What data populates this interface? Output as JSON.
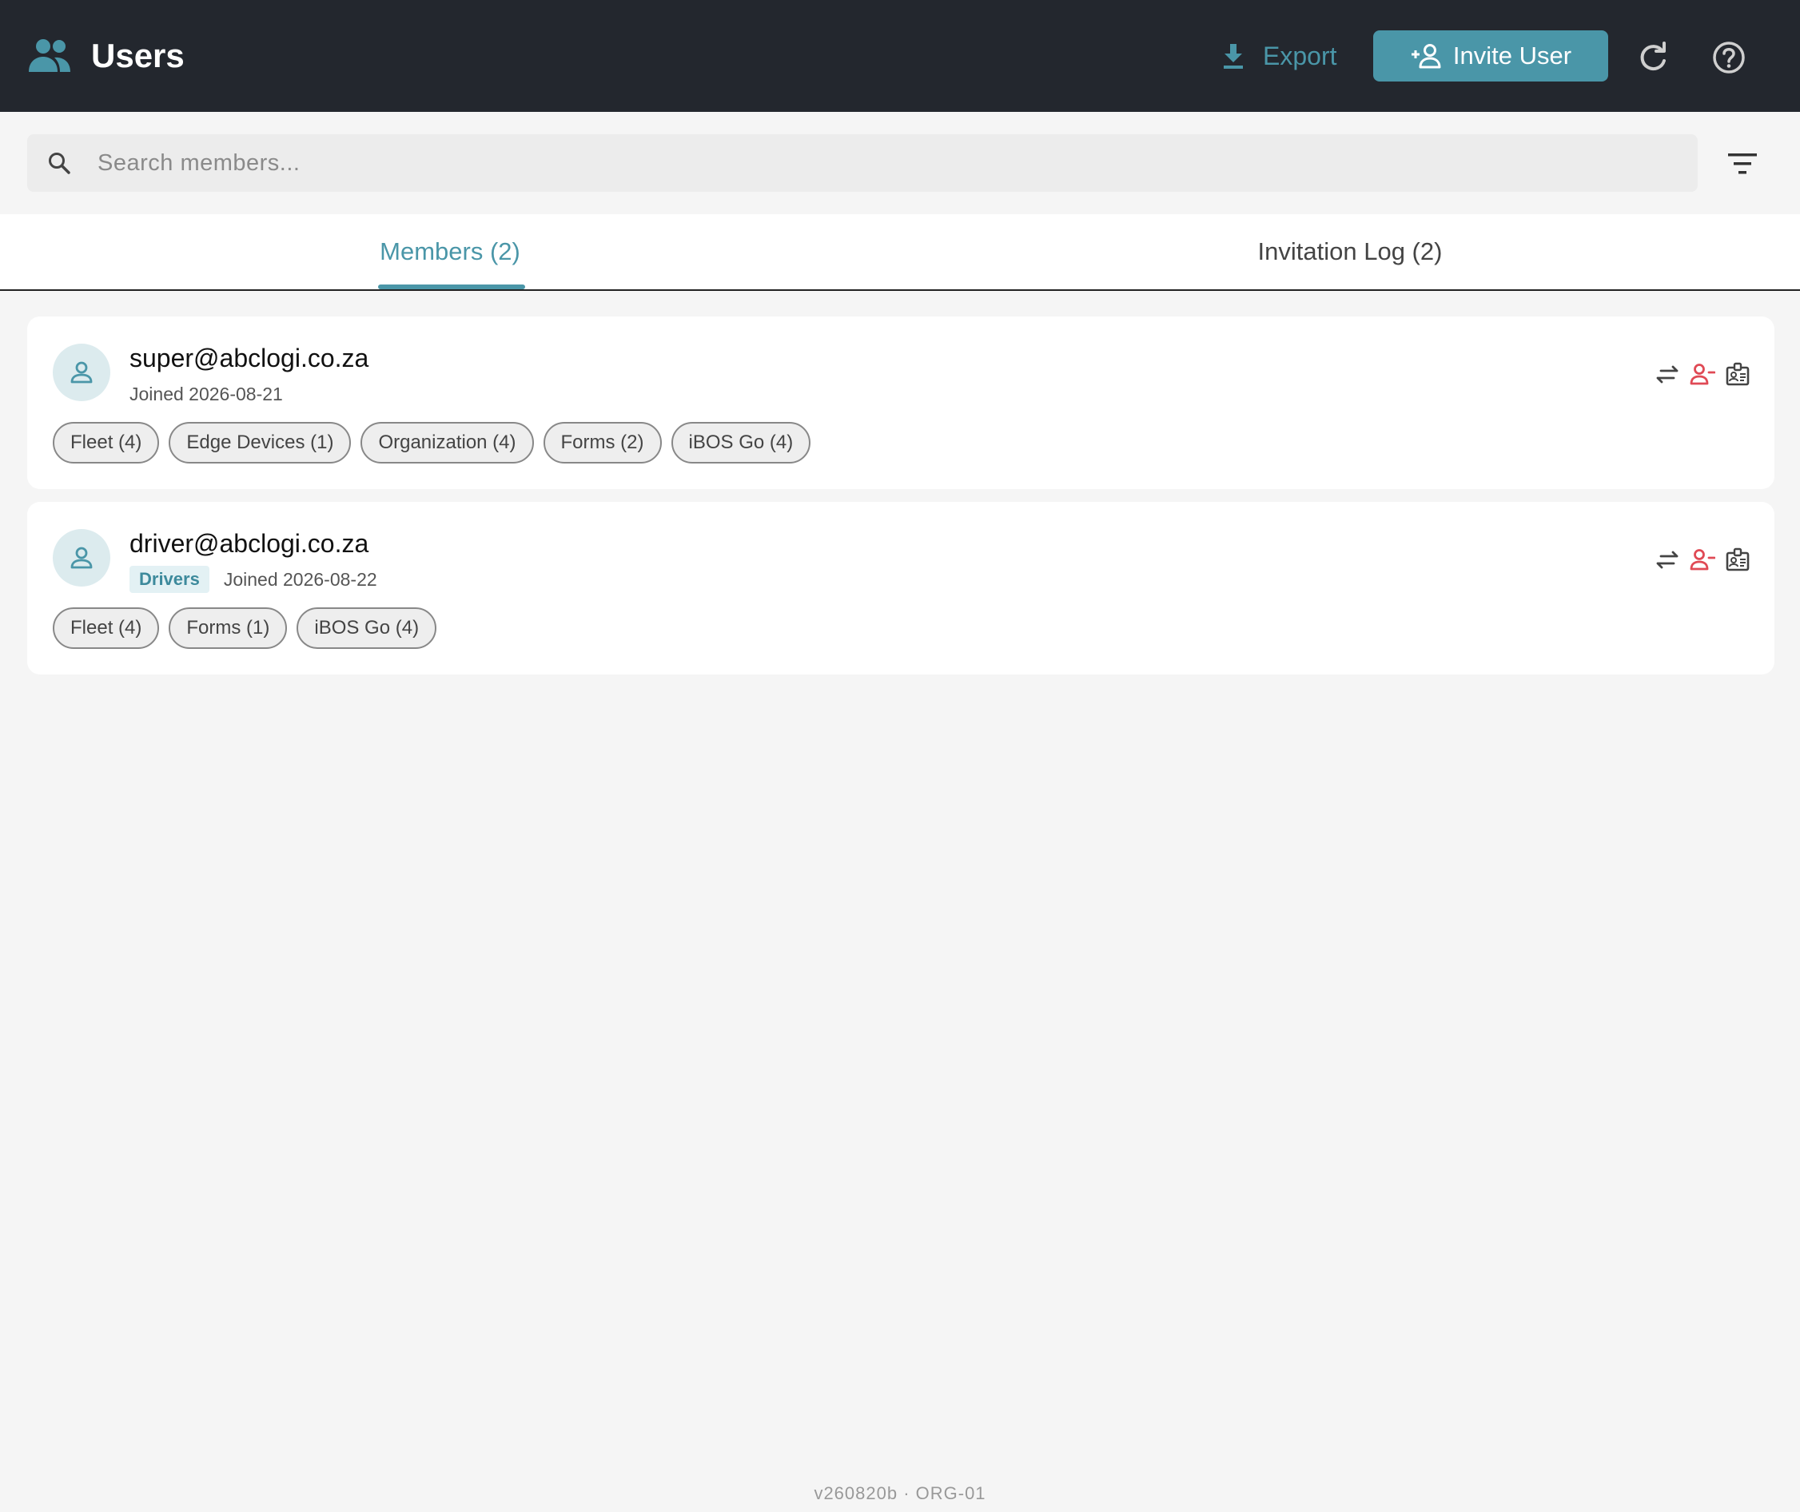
{
  "header": {
    "title": "Users",
    "export_label": "Export",
    "invite_label": "Invite User"
  },
  "search": {
    "placeholder": "Search members..."
  },
  "tabs": [
    {
      "label": "Members (2)",
      "active": true
    },
    {
      "label": "Invitation Log (2)",
      "active": false
    }
  ],
  "members": [
    {
      "email": "super@abclogi.co.za",
      "group": "",
      "joined": "Joined 2026-08-21",
      "chips": [
        "Fleet (4)",
        "Edge Devices (1)",
        "Organization (4)",
        "Forms (2)",
        "iBOS Go (4)"
      ]
    },
    {
      "email": "driver@abclogi.co.za",
      "group": "Drivers",
      "joined": "Joined 2026-08-22",
      "chips": [
        "Fleet (4)",
        "Forms (1)",
        "iBOS Go (4)"
      ]
    }
  ],
  "footer": {
    "version": "v260820b · ORG-01"
  },
  "colors": {
    "header_bg": "#23272e",
    "accent": "#4a96a8",
    "danger": "#e04a55",
    "background": "#f5f5f5"
  },
  "icons": {
    "title": "users-icon",
    "export": "download-icon",
    "invite": "person-add-icon",
    "refresh": "refresh-icon",
    "help": "help-circle-icon",
    "search": "search-icon",
    "filter": "filter-icon",
    "avatar": "person-icon",
    "transfer": "swap-arrows-icon",
    "remove": "person-remove-icon",
    "badge": "id-card-icon"
  }
}
